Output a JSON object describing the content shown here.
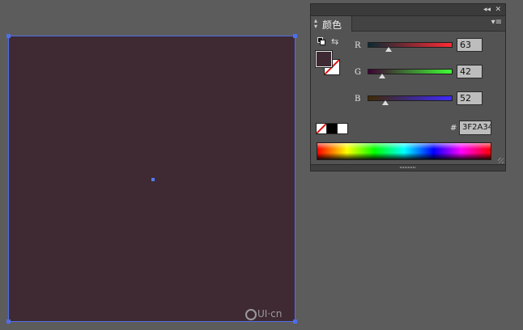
{
  "canvas": {
    "shape_color": "#3f2a34",
    "selection_color": "#4f6fe8"
  },
  "panel": {
    "tab_label": "颜色",
    "collapse_glyph": "◂◂",
    "close_glyph": "✕",
    "menu_glyph": "▾≡",
    "fill_color": "#3f2a34",
    "stroke": "none",
    "channels": [
      {
        "label": "R",
        "value": "63",
        "fraction": 0.247,
        "gradient": [
          "#0c2a34",
          "#ff2a34"
        ]
      },
      {
        "label": "G",
        "value": "42",
        "fraction": 0.165,
        "gradient": [
          "#3f0034",
          "#3fff34"
        ]
      },
      {
        "label": "B",
        "value": "52",
        "fraction": 0.204,
        "gradient": [
          "#3f2a00",
          "#3f2aff"
        ]
      }
    ],
    "hex_label": "#",
    "hex_value": "3F2A34"
  },
  "watermark": {
    "text": "UI·cn"
  }
}
